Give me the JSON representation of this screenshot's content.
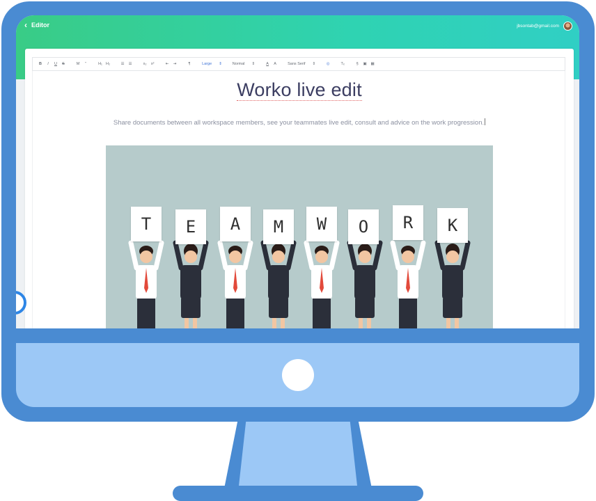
{
  "header": {
    "back_label": "Editor",
    "user_email": "jbsontab@gmail.com"
  },
  "toolbar": {
    "bold": "B",
    "italic": "I",
    "underline": "U",
    "strike": "S",
    "heading_m": "M",
    "quote": "”",
    "h1": "H₁",
    "h2": "H₂",
    "ordered_list": "☰",
    "bullet_list": "☰",
    "subscript": "x₂",
    "superscript": "x²",
    "indent": "⇥",
    "outdent": "⇤",
    "rtl": "¶",
    "size_label": "Large",
    "heading_label": "Normal",
    "text_color": "A",
    "text_bg": "A",
    "font_label": "Sans Serif",
    "link": "§",
    "image": "▣",
    "video": "▦",
    "clean": "Tₓ"
  },
  "document": {
    "title": "Worko live edit",
    "subtitle": "Share documents between all workspace members, see your teammates live edit, consult and advice on the work progression."
  },
  "image": {
    "letters": [
      "T",
      "E",
      "A",
      "M",
      "W",
      "O",
      "R",
      "K"
    ]
  },
  "colors": {
    "monitor_frame": "#4a8bd2",
    "monitor_chin": "#9cc8f6",
    "header_gradient_start": "#39cc86",
    "header_gradient_end": "#30cfc4",
    "title_color": "#3b3d61",
    "image_bg": "#b6cbcb",
    "fab_border": "#2e86e6"
  }
}
